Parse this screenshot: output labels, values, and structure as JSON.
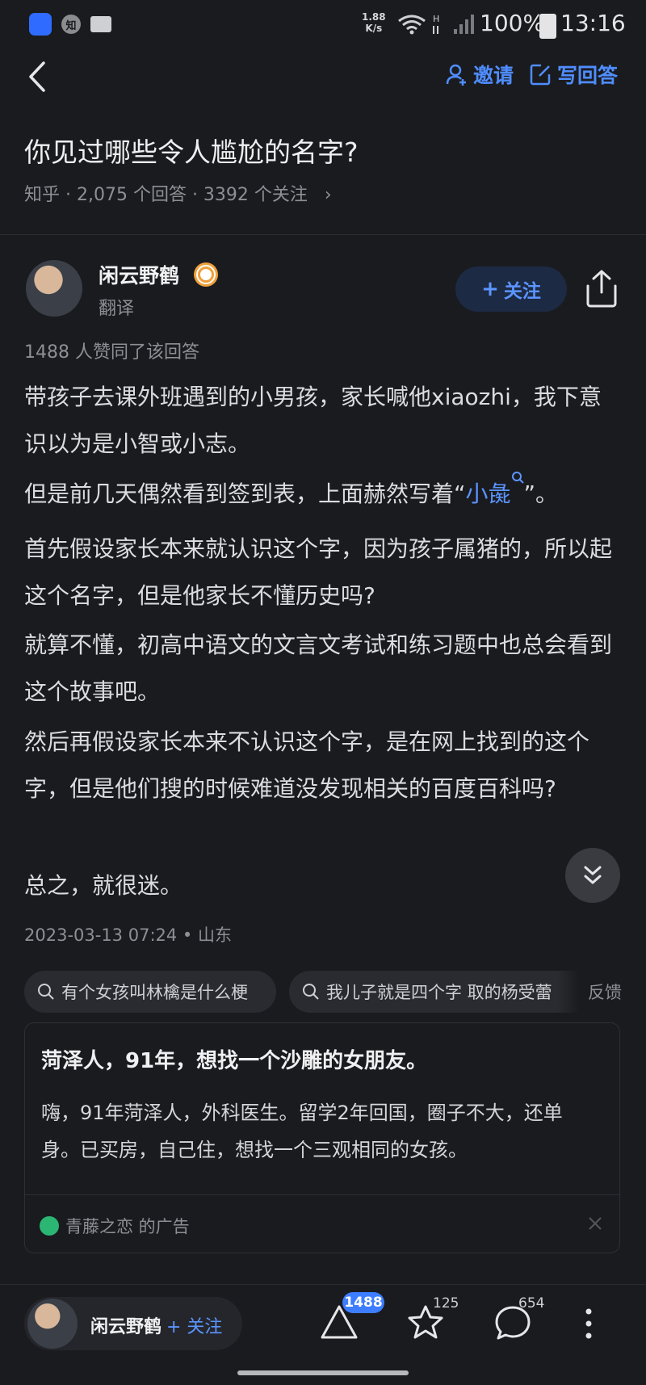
{
  "status_bar": {
    "speed": "1.88",
    "speed_unit": "K/s",
    "battery": "100%",
    "time": "13:16"
  },
  "header": {
    "invite_label": "邀请",
    "write_answer_label": "写回答"
  },
  "question": {
    "title": "你见过哪些令人尴尬的名字?",
    "meta": "知乎 · 2,075 个回答 · 3392 个关注"
  },
  "author": {
    "name": "闲云野鹤",
    "subtitle": "翻译",
    "follow_label": "关注"
  },
  "answer": {
    "likes_text": "1488 人赞同了该回答",
    "p1": "带孩子去课外班遇到的小男孩，家长喊他xiaozhi，我下意识以为是小智或小志。",
    "p2_before": "但是前几天偶然看到签到表，上面赫然写着“",
    "p2_link": "小彘",
    "p2_after": "”。",
    "p3": "首先假设家长本来就认识这个字，因为孩子属猪的，所以起这个名字，但是他家长不懂历史吗?",
    "p4": "就算不懂，初高中语文的文言文考试和练习题中也总会看到这个故事吧。",
    "p5": "然后再假设家长本来不认识这个字，是在网上找到的这个字，但是他们搜的时候难道没发现相关的百度百科吗?",
    "p6": "总之，就很迷。",
    "date": "2023-03-13 07:24 • 山东"
  },
  "related": {
    "chip1": "有个女孩叫林檎是什么梗",
    "chip2": "我儿子就是四个字 取的杨受蕾",
    "feedback": "反馈"
  },
  "ad": {
    "title": "菏泽人，91年，想找一个沙雕的女朋友。",
    "text": "嗨，91年菏泽人，外科医生。留学2年回国，圈子不大，还单身。已买房，自己住，想找一个三观相同的女孩。",
    "brand": "青藤之恋 的广告"
  },
  "bottom_bar": {
    "author_name": "闲云野鹤",
    "follow_label": "+ 关注",
    "vote_count": "1488",
    "favorite_count": "125",
    "comment_count": "654"
  },
  "colors": {
    "background": "#1a1b1f",
    "accent": "#5b95ff",
    "muted": "#8e8f94"
  },
  "icons": [
    "baidu-icon",
    "zhihu-icon",
    "folder-icon",
    "wifi-icon",
    "signal-icon",
    "battery-icon",
    "back-icon",
    "invite-icon",
    "edit-icon",
    "badge-icon",
    "share-icon",
    "search-icon",
    "chevrons-down-icon",
    "close-icon",
    "upvote-icon",
    "star-icon",
    "comment-icon",
    "more-icon"
  ]
}
